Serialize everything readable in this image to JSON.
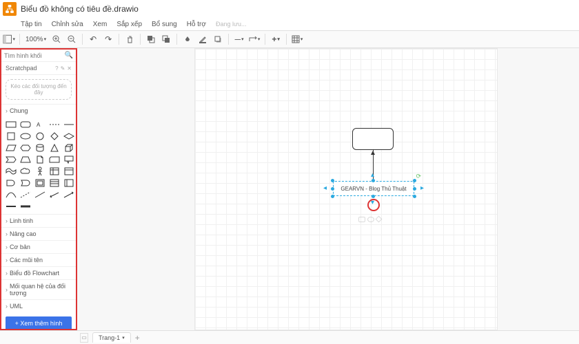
{
  "title": "Biểu đồ không có tiêu đề.drawio",
  "menus": [
    "Tập tin",
    "Chỉnh sửa",
    "Xem",
    "Sắp xếp",
    "Bổ sung",
    "Hỗ trợ"
  ],
  "saving": "Đang lưu...",
  "zoom": "100%",
  "search_placeholder": "Tìm hình khối",
  "scratchpad_label": "Scratchpad",
  "scratchpad_hint": "Kéo các đối tượng đến đây",
  "categories": {
    "chung": "Chung",
    "linh_tinh": "Linh tinh",
    "nang_cao": "Nâng cao",
    "co_ban": "Cơ bản",
    "mui_ten": "Các mũi tên",
    "flowchart": "Biểu đồ Flowchart",
    "quan_he": "Mối quan hệ của đối tượng",
    "uml": "UML"
  },
  "more_shapes": "+ Xem thêm hình",
  "canvas": {
    "node_label": "GEARVN - Blog Thủ Thuật"
  },
  "page_tab": "Trang-1"
}
